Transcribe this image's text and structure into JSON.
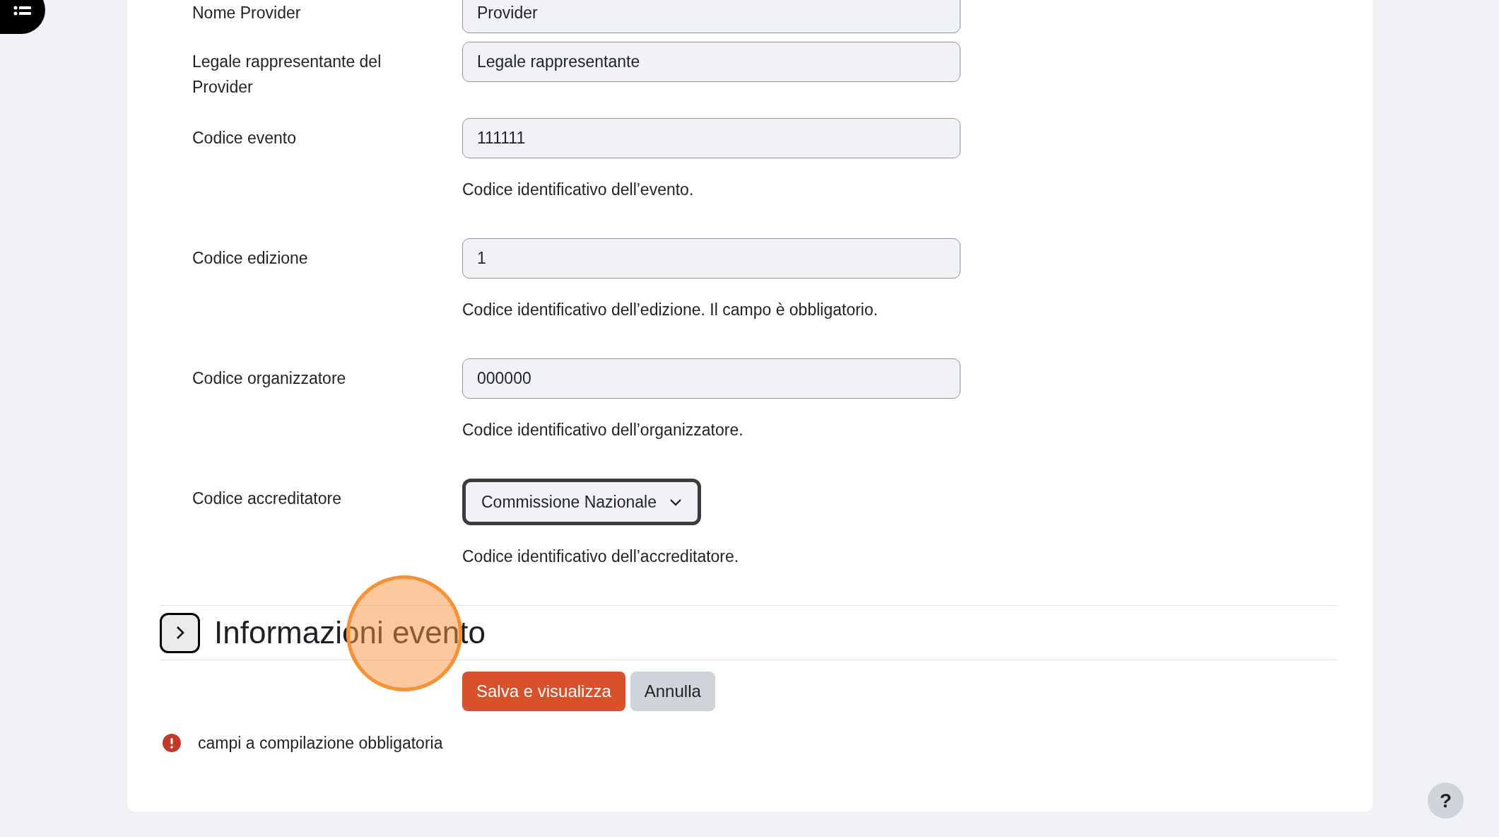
{
  "fields": [
    {
      "kind": "input",
      "label": "Nome Provider",
      "value": "Provider"
    },
    {
      "kind": "input",
      "label": "Legale rappresentante del Provider",
      "value": "Legale rappresentante"
    },
    {
      "kind": "input",
      "label": "Codice evento",
      "value": "111111",
      "help": "Codice identificativo dell’evento."
    },
    {
      "kind": "input",
      "label": "Codice edizione",
      "value": "1",
      "help": "Codice identificativo dell’edizione. Il campo è obbligatorio."
    },
    {
      "kind": "input",
      "label": "Codice organizzatore",
      "value": "000000",
      "help": "Codice identificativo dell’organizzatore."
    },
    {
      "kind": "select",
      "label": "Codice accreditatore",
      "value": "Commissione Nazionale",
      "help": "Codice identificativo dell’accreditatore."
    }
  ],
  "section": {
    "title": "Informazioni evento",
    "expanded": false
  },
  "buttons": [
    {
      "label": "Salva e visualizza",
      "kind": "primary"
    },
    {
      "label": "Annulla",
      "kind": "secondary"
    }
  ],
  "required_note": "campi a compilazione obbligatoria",
  "help_button": "?"
}
